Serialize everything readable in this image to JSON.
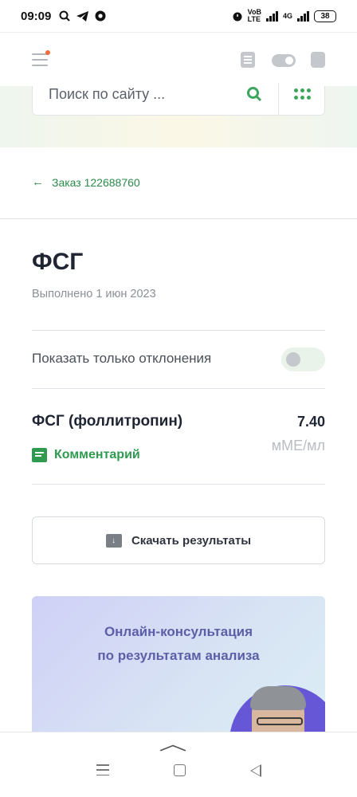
{
  "status_bar": {
    "time": "09:09",
    "network_label_1": "VoB",
    "network_label_2": "LTE",
    "network_label_3": "4G",
    "battery": "38"
  },
  "header": {
    "menu_icon": "hamburger-icon",
    "icons": [
      "list-icon",
      "toggle-icon",
      "bag-icon"
    ]
  },
  "search": {
    "placeholder": "Поиск по сайту ..."
  },
  "breadcrumb": {
    "back_label": "Заказ 122688760"
  },
  "test": {
    "title": "ФСГ",
    "completed": "Выполнено 1 июн 2023",
    "toggle_label": "Показать только отклонения",
    "toggle_on": false
  },
  "result": {
    "name": "ФСГ (фоллитропин)",
    "value": "7.40",
    "unit": "мМЕ/мл",
    "comment_label": "Комментарий"
  },
  "download": {
    "label": "Скачать результаты"
  },
  "promo": {
    "line1": "Онлайн-консультация",
    "line2": "по результатам анализа"
  },
  "colors": {
    "accent_green": "#2f9a50",
    "promo_text": "#5c5fa8"
  }
}
